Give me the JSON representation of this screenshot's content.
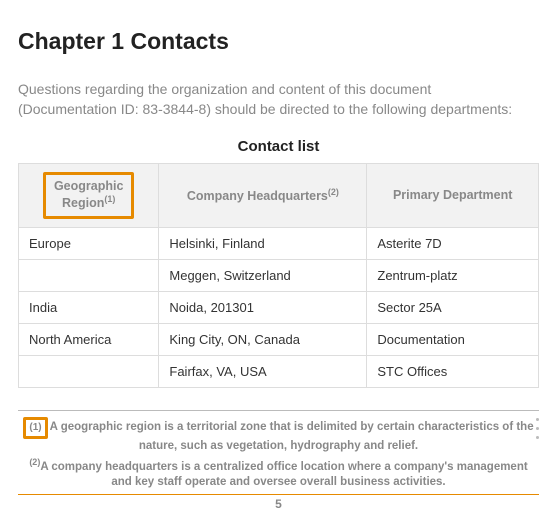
{
  "chapter_heading": "Chapter 1   Contacts",
  "intro_line1": "Questions regarding the organization and content of this document",
  "intro_line2": "(Documentation ID: 83-3844-8) should be directed to the following departments:",
  "table": {
    "caption": "Contact list",
    "headers": {
      "col1_line1": "Geographic",
      "col1_line2": "Region",
      "col1_sup": "(1)",
      "col2": "Company Headquarters",
      "col2_sup": "(2)",
      "col3": "Primary Department"
    },
    "rows": [
      {
        "region": "Europe",
        "hq": "Helsinki, Finland",
        "dept": "Asterite 7D"
      },
      {
        "region": "",
        "hq": "Meggen, Switzerland",
        "dept": "Zentrum-platz"
      },
      {
        "region": "India",
        "hq": "Noida, 201301",
        "dept": "Sector 25A"
      },
      {
        "region": "North America",
        "hq": "King City, ON, Canada",
        "dept": "Documentation"
      },
      {
        "region": "",
        "hq": "Fairfax, VA, USA",
        "dept": "STC Offices"
      }
    ]
  },
  "footnotes": {
    "marker1": "(1)",
    "text1": "A geographic region is a territorial zone that is delimited by certain characteristics of the nature, such as vegetation, hydrography and relief.",
    "marker2": "(2)",
    "text2": "A company headquarters is a centralized office location where a company's management and key staff operate and oversee overall business activities."
  },
  "page_number": "5"
}
